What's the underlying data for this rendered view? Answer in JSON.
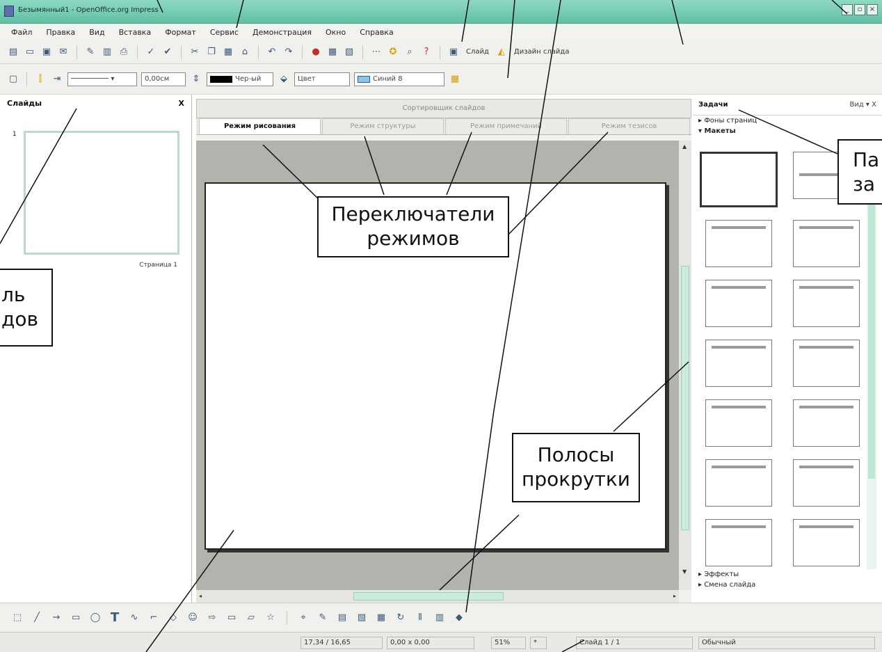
{
  "window": {
    "title": "Безымянный1 - OpenOffice.org Impress",
    "buttons": [
      "_",
      "▫",
      "×"
    ]
  },
  "menu": [
    "Файл",
    "Правка",
    "Вид",
    "Вставка",
    "Формат",
    "Сервис",
    "Демонстрация",
    "Окно",
    "Справка"
  ],
  "toolbar1": {
    "slide_label": "Слайд",
    "design_label": "Дизайн слайда"
  },
  "toolbar2": {
    "line_width": "0,00см",
    "line_color": "Чер-ый",
    "area_style": "Цвет",
    "area_color": "Синий 8"
  },
  "slides_pane": {
    "title": "Слайды",
    "close": "X",
    "thumb_number": "1",
    "thumb_label": "Страница 1"
  },
  "main": {
    "sorter_tab": "Сортировщик слайдов",
    "tabs": [
      "Режим рисования",
      "Режим структуры",
      "Режим примечаний",
      "Режим тезисов"
    ]
  },
  "task_pane": {
    "title": "Задачи",
    "view": "Вид ▾ X",
    "sections_top": [
      "▸ Фоны страниц",
      "▾ Макеты"
    ],
    "sections_bottom": [
      "▸ Эффекты",
      "▸ Смена слайда"
    ]
  },
  "status": {
    "position": "17,34 / 16,65",
    "size": "0,00 x 0,00",
    "zoom": "51%",
    "modified": "*",
    "slide": "Слайд 1 / 1",
    "layout": "Обычный"
  },
  "callouts": {
    "mode_switches": [
      "Переключатели",
      "режимов"
    ],
    "scrollbars": [
      "Полосы",
      "прокрутки"
    ],
    "slides_panel": [
      "ль",
      "дов"
    ],
    "task_panel": [
      "Па",
      "за"
    ]
  }
}
